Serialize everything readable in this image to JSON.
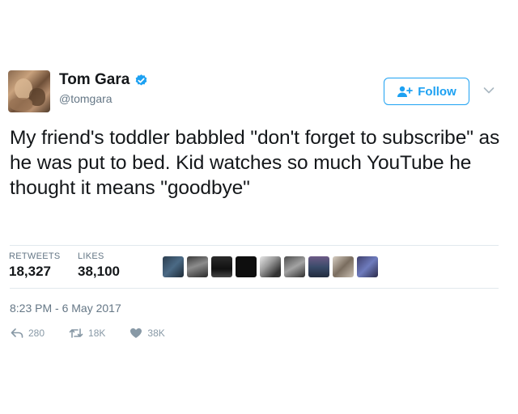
{
  "author": {
    "display_name": "Tom Gara",
    "handle": "@tomgara",
    "verified": true
  },
  "follow_button": {
    "label": "Follow",
    "icon": "add-user-icon"
  },
  "menu_icon": "chevron-down-icon",
  "tweet": {
    "text": "My friend's toddler babbled \"don't forget to subscribe\" as he was put to bed. Kid watches so much YouTube he thought it means \"goodbye\""
  },
  "stats": {
    "retweets_label": "RETWEETS",
    "retweets_value": "18,327",
    "likes_label": "LIKES",
    "likes_value": "38,100"
  },
  "likers": [
    {
      "icon": "liker-avatar-1"
    },
    {
      "icon": "liker-avatar-2"
    },
    {
      "icon": "liker-avatar-3"
    },
    {
      "icon": "liker-avatar-4"
    },
    {
      "icon": "liker-avatar-5"
    },
    {
      "icon": "liker-avatar-6"
    },
    {
      "icon": "liker-avatar-7"
    },
    {
      "icon": "liker-avatar-8"
    },
    {
      "icon": "liker-avatar-9"
    }
  ],
  "timestamp": "8:23 PM - 6 May 2017",
  "actions": {
    "reply_count": "280",
    "retweet_count": "18K",
    "like_count": "38K"
  },
  "colors": {
    "accent": "#1da1f2",
    "text": "#14171a",
    "muted": "#657786",
    "divider": "#e1e8ed"
  }
}
